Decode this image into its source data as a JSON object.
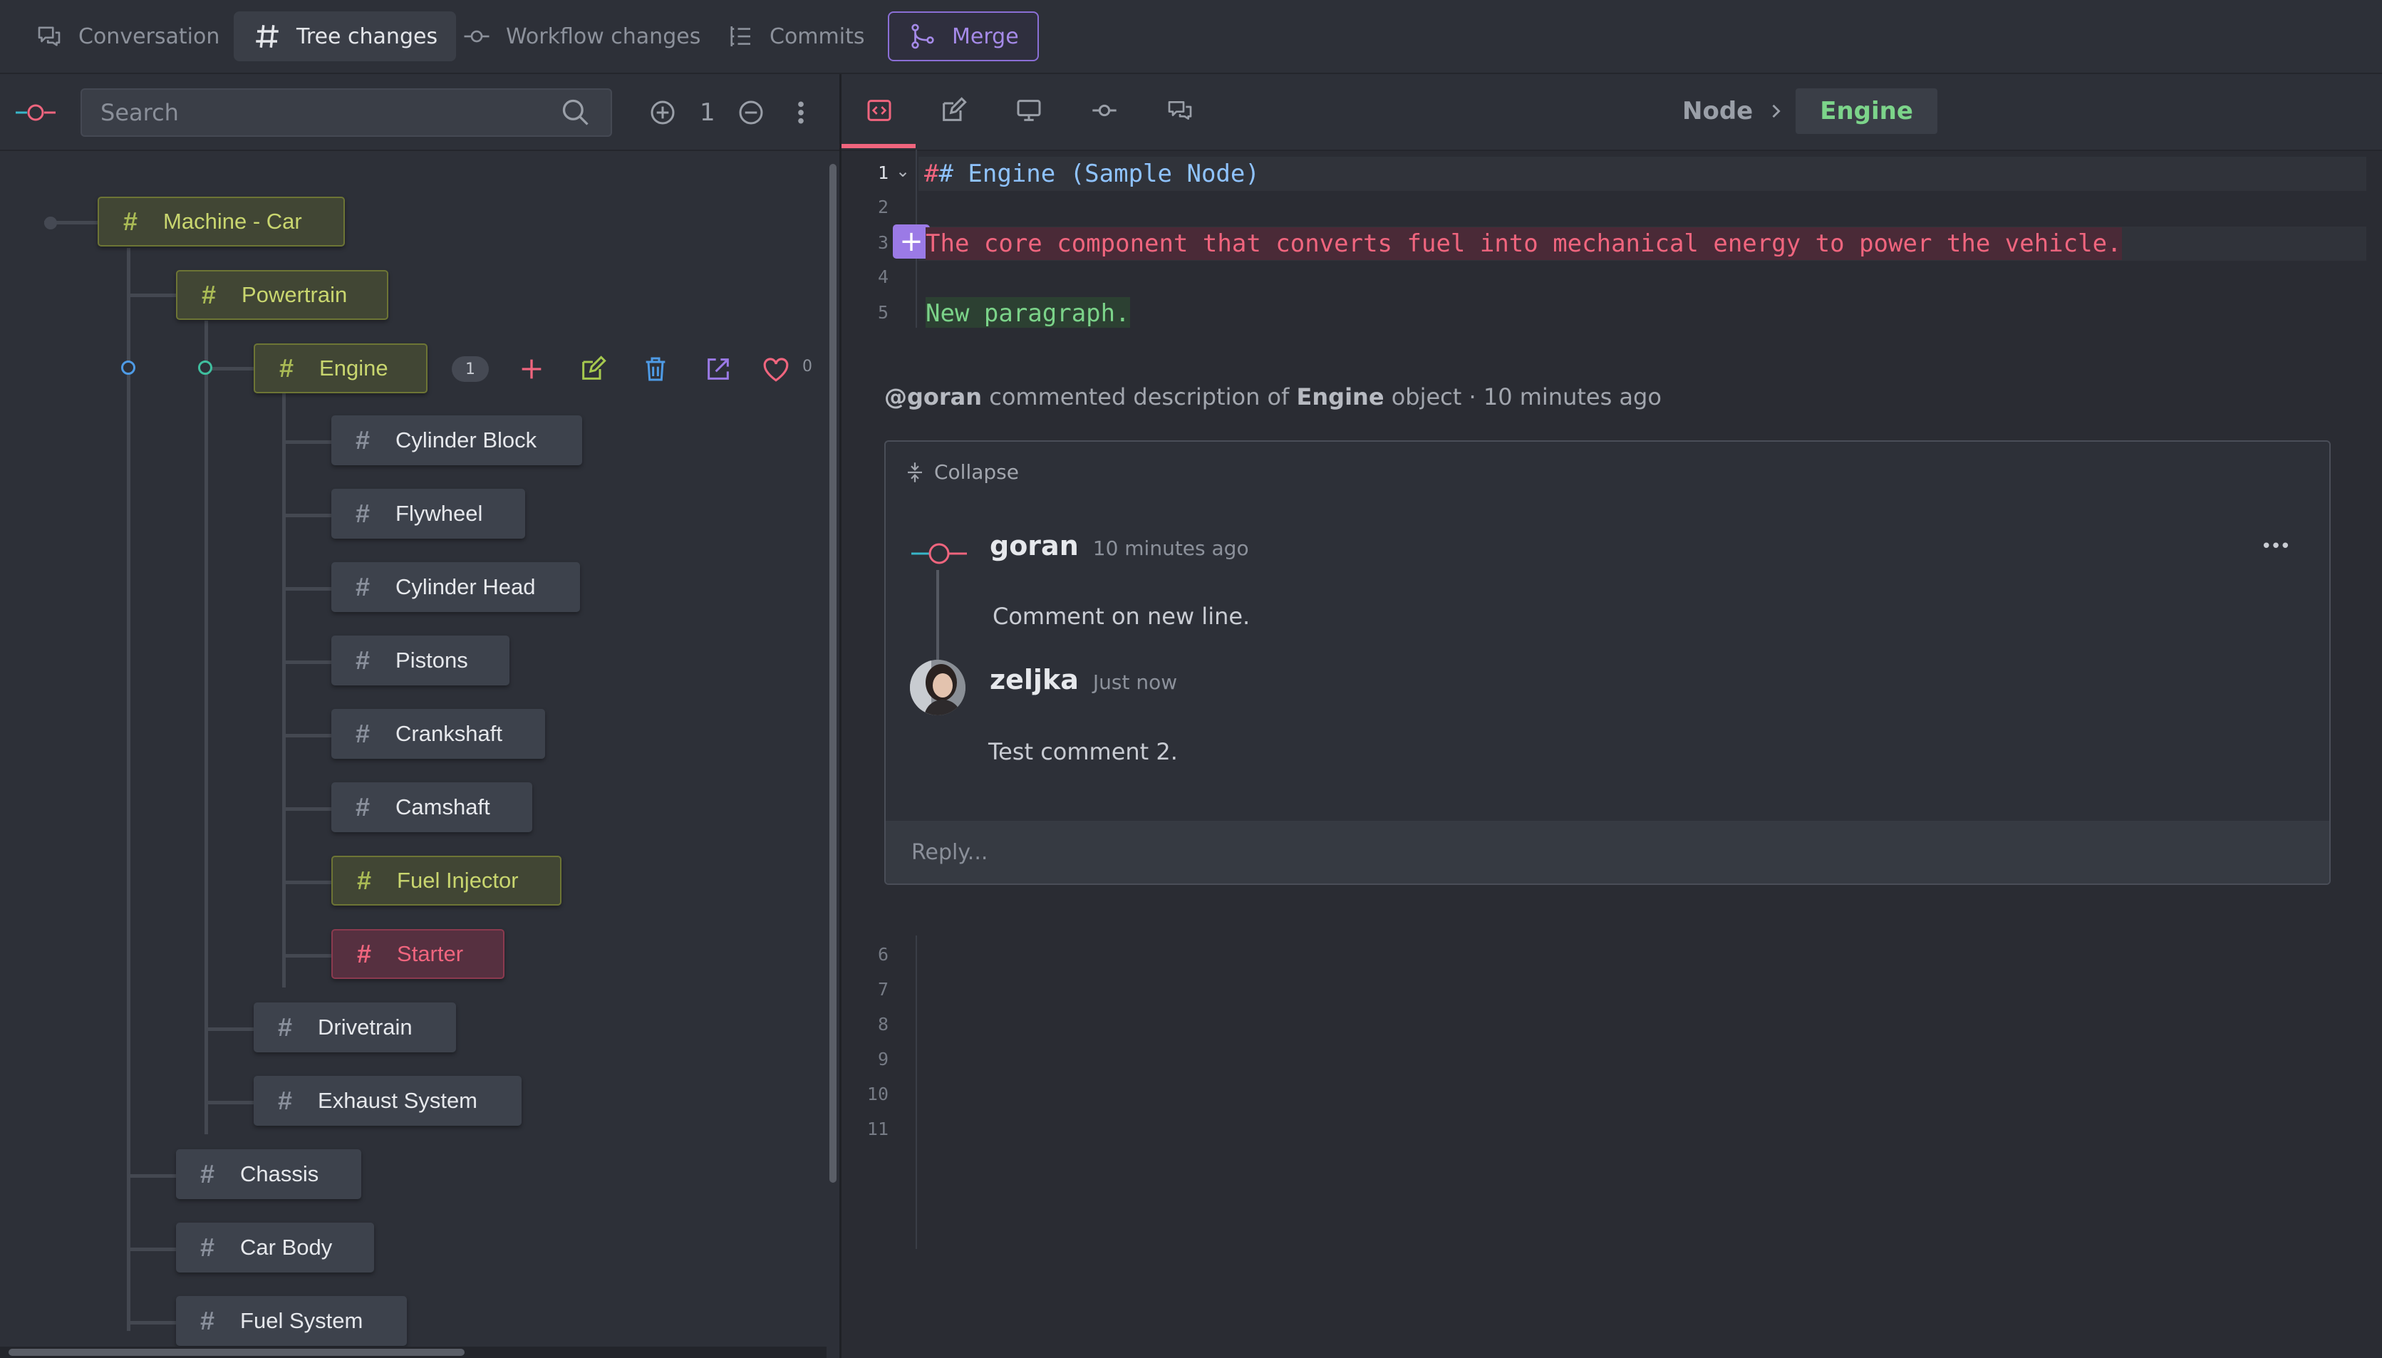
{
  "tabs": {
    "conversation": "Conversation",
    "tree_changes": "Tree changes",
    "workflow_changes": "Workflow changes",
    "commits": "Commits",
    "merge": "Merge"
  },
  "left_toolbar": {
    "search_placeholder": "Search",
    "expand_level": "1"
  },
  "tree": {
    "root": "Machine - Car",
    "powertrain": "Powertrain",
    "engine": "Engine",
    "engine_comment_count": "1",
    "engine_like_count": "0",
    "engine_children": [
      "Cylinder Block",
      "Flywheel",
      "Cylinder Head",
      "Pistons",
      "Crankshaft",
      "Camshaft",
      "Fuel Injector",
      "Starter"
    ],
    "powertrain_children_rest": [
      "Drivetrain",
      "Exhaust System"
    ],
    "car_children_rest": [
      "Chassis",
      "Car Body",
      "Fuel System"
    ],
    "hash": "#"
  },
  "breadcrumb": {
    "parent": "Node",
    "current": "Engine"
  },
  "editor": {
    "lines": [
      {
        "num": "1",
        "text": "# Engine (Sample Node)"
      },
      {
        "num": "2",
        "text": ""
      },
      {
        "num": "3",
        "text": "The core component that converts fuel into mechanical energy to power the vehicle."
      },
      {
        "num": "4",
        "text": ""
      },
      {
        "num": "5",
        "text": "New paragraph."
      }
    ],
    "lines_after": [
      "6",
      "7",
      "8",
      "9",
      "10",
      "11"
    ],
    "add_glyph": "+",
    "fold_glyph": "⌄"
  },
  "comment_thread": {
    "author": "@goran",
    "action": "commented description of",
    "object": "Engine",
    "object_suffix": "object · 10 minutes ago",
    "collapse_label": "Collapse",
    "more_glyph": "•••",
    "comments": [
      {
        "user": "goran",
        "time": "10 minutes ago",
        "text": "Comment on new line."
      },
      {
        "user": "zeljka",
        "time": "Just now",
        "text": "Test comment 2."
      }
    ],
    "reply_placeholder": "Reply..."
  },
  "colors": {
    "accent_purple": "#9b7ae6",
    "added_green": "#7bd389",
    "deleted_red": "#f0657e",
    "modified_olive": "#c9d66f",
    "breadcrumb_green": "#7cd48a",
    "heading_blue": "#8fc3ff"
  }
}
